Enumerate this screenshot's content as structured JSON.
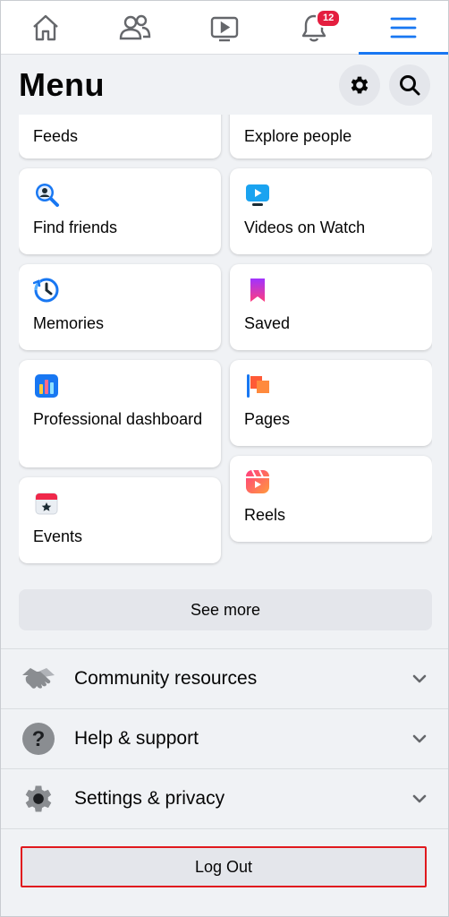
{
  "nav": {
    "tabs": [
      {
        "icon": "home-icon"
      },
      {
        "icon": "friends-icon"
      },
      {
        "icon": "watch-icon"
      },
      {
        "icon": "notifications-icon",
        "badge": "12"
      },
      {
        "icon": "menu-icon",
        "active": true
      }
    ]
  },
  "header": {
    "title": "Menu"
  },
  "shortcuts": {
    "left": [
      {
        "label": "Feeds"
      },
      {
        "label": "Find friends",
        "icon": "find-friends-icon"
      },
      {
        "label": "Memories",
        "icon": "memories-icon"
      },
      {
        "label": "Professional dashboard",
        "icon": "dashboard-icon"
      },
      {
        "label": "Events",
        "icon": "events-icon"
      }
    ],
    "right": [
      {
        "label": "Explore people"
      },
      {
        "label": "Videos on Watch",
        "icon": "watch-video-icon"
      },
      {
        "label": "Saved",
        "icon": "saved-icon"
      },
      {
        "label": "Pages",
        "icon": "pages-icon"
      },
      {
        "label": "Reels",
        "icon": "reels-icon"
      }
    ]
  },
  "see_more": "See more",
  "sections": [
    {
      "label": "Community resources",
      "icon": "handshake-icon"
    },
    {
      "label": "Help & support",
      "icon": "help-icon"
    },
    {
      "label": "Settings & privacy",
      "icon": "gear-icon"
    }
  ],
  "logout": "Log Out",
  "colors": {
    "accent": "#1877f2",
    "badge": "#e41e3f",
    "outline": "#e0191e"
  }
}
